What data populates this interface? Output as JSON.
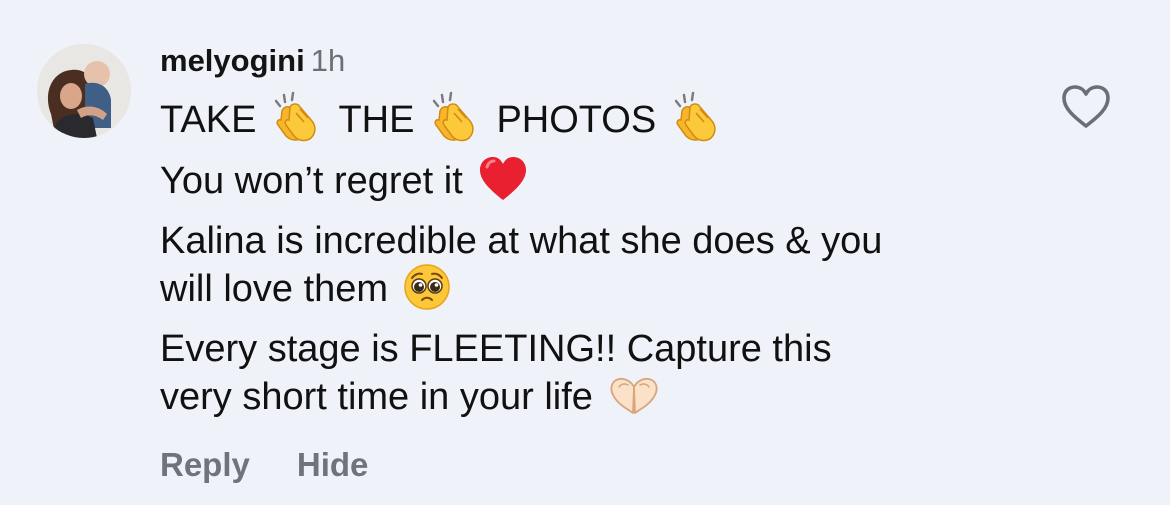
{
  "comment": {
    "username": "melyogini",
    "time": "1h",
    "line1": {
      "w1": "TAKE",
      "w2": "THE",
      "w3": "PHOTOS"
    },
    "line2": "You won’t regret it",
    "line3": "Kalina is incredible at what she does & you",
    "line4": "will love them",
    "line5": "Every stage is FLEETING!! Capture this",
    "line6": "very short time in your life",
    "emojis": {
      "clap": "clapping-hands-icon",
      "heart": "red-heart-icon",
      "pleading": "pleading-face-icon",
      "heart_hands": "heart-hands-icon"
    }
  },
  "actions": {
    "reply": "Reply",
    "hide": "Hide"
  },
  "colors": {
    "background": "#eff2f8",
    "secondary_text": "#6c6f75",
    "action_text": "#70737a",
    "heart_red": "#e8202f"
  }
}
